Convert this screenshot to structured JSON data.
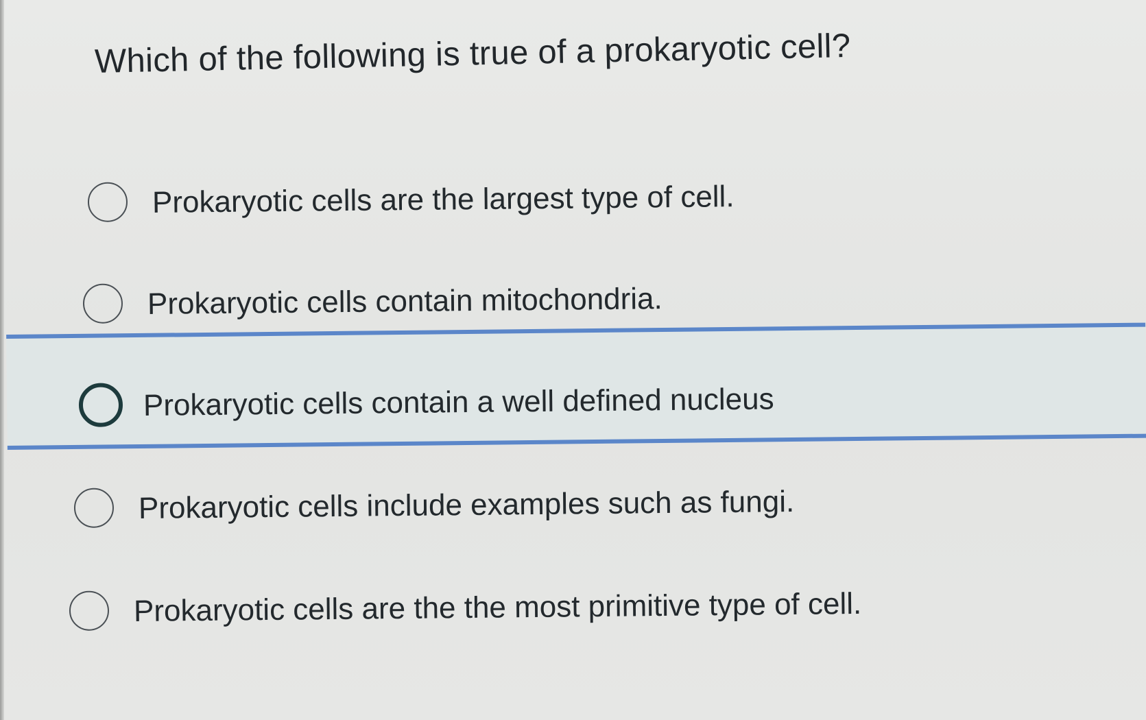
{
  "question": {
    "text": "Which of the following is true of a prokaryotic cell?"
  },
  "options": [
    {
      "label": "Prokaryotic cells are the largest type of cell.",
      "selected": false
    },
    {
      "label": "Prokaryotic cells contain mitochondria.",
      "selected": false
    },
    {
      "label": "Prokaryotic cells contain a well defined nucleus",
      "selected": false,
      "highlighted": true
    },
    {
      "label": "Prokaryotic cells include examples such as fungi.",
      "selected": false
    },
    {
      "label": "Prokaryotic cells are the the most primitive type of cell.",
      "selected": false
    }
  ],
  "colors": {
    "background": "#e5e6e4",
    "text": "#23292d",
    "highlight_fill": "#dfe6e6",
    "highlight_border": "#5b86c9"
  }
}
